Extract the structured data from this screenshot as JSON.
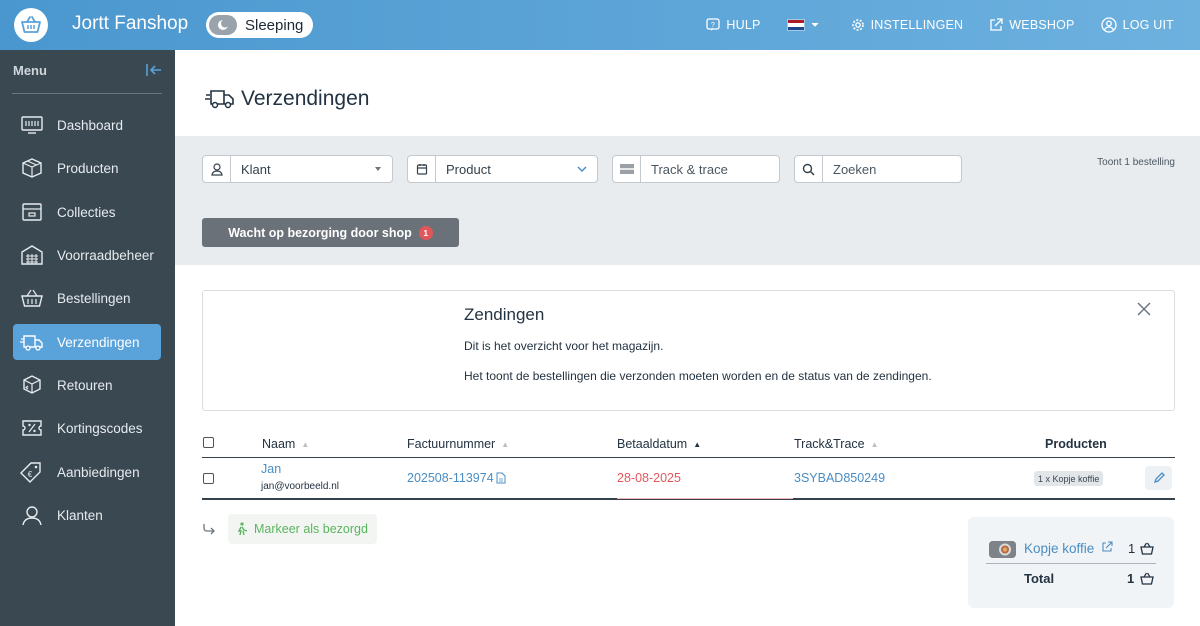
{
  "topbar": {
    "shop_name": "Jortt Fanshop",
    "status": "Sleeping",
    "nav": {
      "help": "HULP",
      "settings": "INSTELLINGEN",
      "webshop": "WEBSHOP",
      "logout": "LOG UIT"
    },
    "language_flag": "nl"
  },
  "sidebar": {
    "heading": "Menu",
    "items": [
      {
        "label": "Dashboard",
        "icon": "dashboard-icon"
      },
      {
        "label": "Producten",
        "icon": "box-icon"
      },
      {
        "label": "Collecties",
        "icon": "folder-icon"
      },
      {
        "label": "Voorraadbeheer",
        "icon": "warehouse-icon"
      },
      {
        "label": "Bestellingen",
        "icon": "basket-icon"
      },
      {
        "label": "Verzendingen",
        "icon": "truck-icon",
        "active": true
      },
      {
        "label": "Retouren",
        "icon": "return-box-icon"
      },
      {
        "label": "Kortingscodes",
        "icon": "percent-tag-icon"
      },
      {
        "label": "Aanbiedingen",
        "icon": "euro-tag-icon"
      },
      {
        "label": "Klanten",
        "icon": "user-icon"
      }
    ]
  },
  "page": {
    "title": "Verzendingen"
  },
  "filters": {
    "customer": "Klant",
    "product": "Product",
    "track_placeholder": "Track & trace",
    "search_placeholder": "Zoeken",
    "count_text": "Toont 1 bestelling",
    "status_button": "Wacht op bezorging door shop",
    "status_count": "1"
  },
  "info": {
    "title": "Zendingen",
    "line1": "Dit is het overzicht voor het magazijn.",
    "line2": "Het toont de bestellingen die verzonden moeten worden en de status van de zendingen."
  },
  "table": {
    "headers": {
      "name": "Naam",
      "invoice": "Factuurnummer",
      "paid_date": "Betaaldatum",
      "track": "Track&Trace",
      "products": "Producten"
    },
    "rows": [
      {
        "name": "Jan",
        "email": "jan@voorbeeld.nl",
        "invoice": "202508-113974",
        "paid_date": "28-08-2025",
        "track": "3SYBAD850249",
        "products": "1 x Kopje koffie"
      }
    ]
  },
  "actions": {
    "mark_delivered": "Markeer als bezorgd"
  },
  "cart": {
    "item_name": "Kopje koffie",
    "item_qty": "1",
    "total_label": "Total",
    "total_qty": "1"
  },
  "colors": {
    "topbar": "#5aa2da",
    "sidebar": "#3a4852",
    "active": "#5aa2da",
    "link": "#4a8dc4",
    "date_red": "#e3575b",
    "success": "#5ab55e"
  }
}
